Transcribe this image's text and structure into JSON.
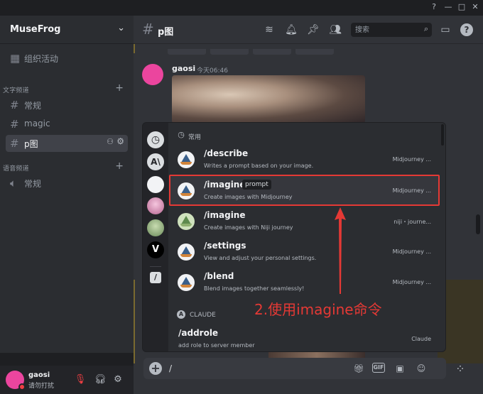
{
  "window": {
    "controls": [
      "?",
      "—",
      "□",
      "✕"
    ]
  },
  "sidebar": {
    "server_name": "MuseFrog",
    "activity_label": "组织活动",
    "text_category": "文字频道",
    "voice_category": "语音频道",
    "text_channels": [
      {
        "label": "常规"
      },
      {
        "label": "magic"
      },
      {
        "label": "p图",
        "active": true
      }
    ],
    "voice_channels": [
      {
        "label": "常规"
      }
    ]
  },
  "user": {
    "name": "gaosi",
    "status": "请勿打扰"
  },
  "header": {
    "channel_name": "p图",
    "search_placeholder": "搜索"
  },
  "message": {
    "author": "gaosi",
    "time": "今天06:46"
  },
  "input": {
    "value": "/"
  },
  "popup": {
    "recent_label": "常用",
    "claude_label": "CLAUDE",
    "commands": [
      {
        "name": "/describe",
        "desc": "Writes a prompt based on your image.",
        "source": "Midjourney ...",
        "icon": "midjourney-icon"
      },
      {
        "name": "/imagine",
        "option": "prompt",
        "desc": "Create images with Midjourney",
        "source": "Midjourney ...",
        "icon": "midjourney-icon",
        "highlighted": true
      },
      {
        "name": "/imagine",
        "desc": "Create images with Niji journey",
        "source": "niji・journe...",
        "icon": "niji-icon"
      },
      {
        "name": "/settings",
        "desc": "View and adjust your personal settings.",
        "source": "Midjourney ...",
        "icon": "midjourney-icon"
      },
      {
        "name": "/blend",
        "desc": "Blend images together seamlessly!",
        "source": "Midjourney ...",
        "icon": "midjourney-icon"
      }
    ],
    "claude_command": {
      "name": "/addrole",
      "desc": "add role to server member",
      "source": "Claude"
    }
  },
  "annotation": {
    "text": "2.使用imagine命令",
    "color": "#e53935"
  },
  "colors": {
    "accent": "#5865f2",
    "annotation": "#e53935",
    "background": "#313338"
  }
}
